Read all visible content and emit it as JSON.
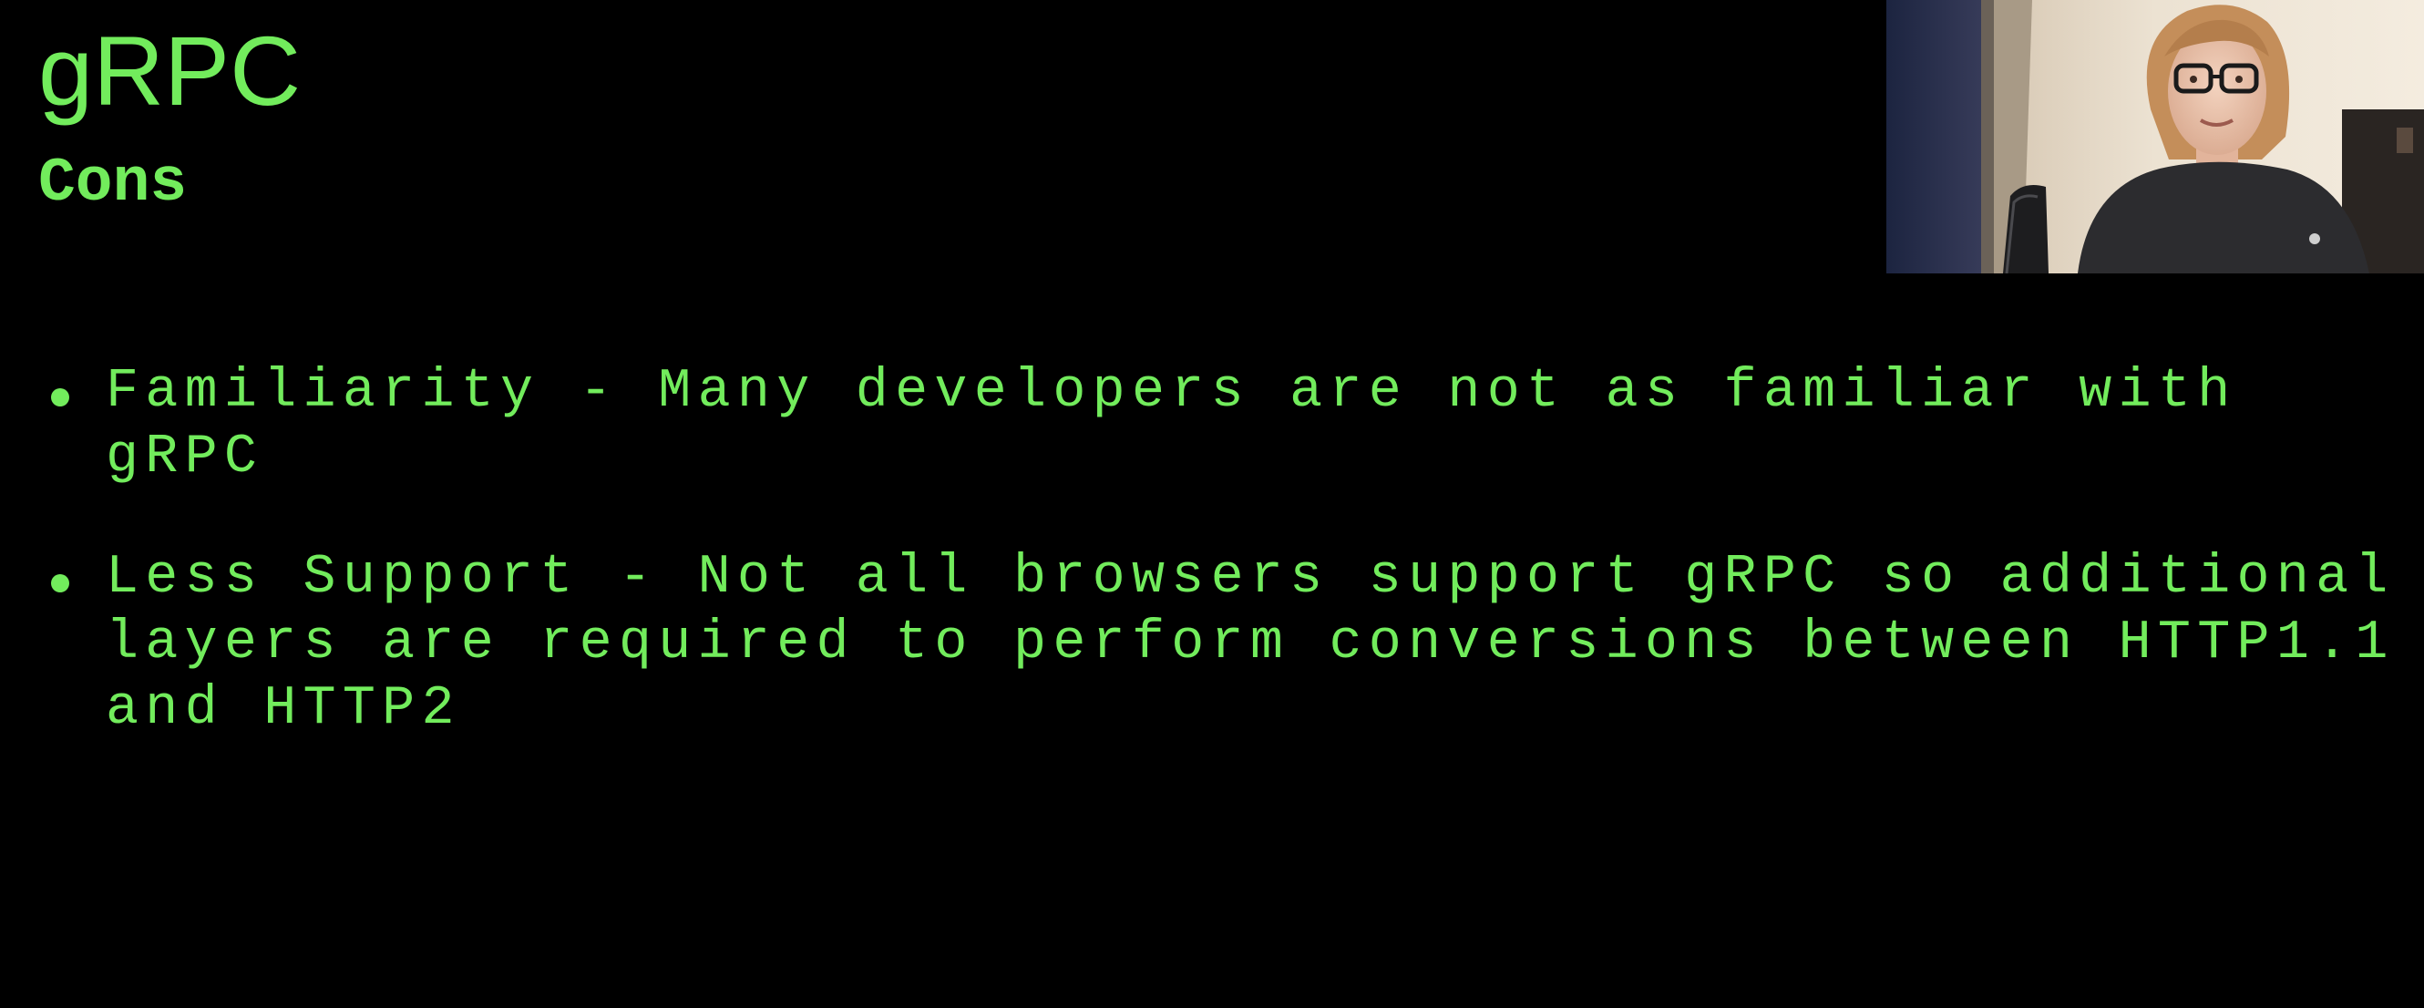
{
  "slide": {
    "title": "gRPC",
    "subtitle": "Cons",
    "bullets": [
      {
        "line1": "Familiarity - Many developers are not as familiar with",
        "line2": "gRPC"
      },
      {
        "line1": "Less Support - Not all browsers support gRPC so additional",
        "line2": "layers are required to perform conversions between HTTP1.1",
        "line3": "and HTTP2"
      }
    ]
  },
  "colors": {
    "background": "#000000",
    "text": "#72ec5c"
  },
  "webcam": {
    "content": "presenter-video"
  }
}
